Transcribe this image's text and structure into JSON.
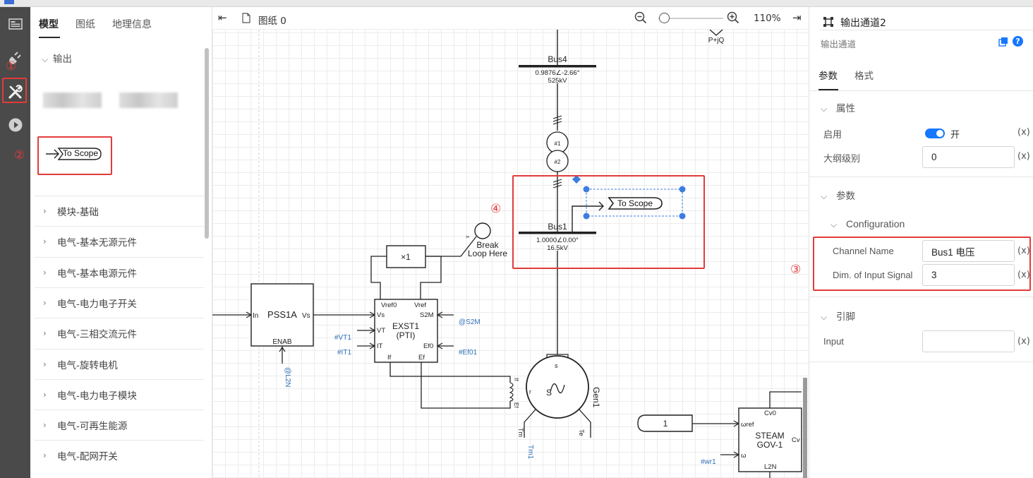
{
  "rail": {
    "items": [
      "panel-icon",
      "plug-icon",
      "tools-icon",
      "play-icon"
    ]
  },
  "library": {
    "tabs": [
      "模型",
      "图纸",
      "地理信息"
    ],
    "active_tab": "模型",
    "section_output": "输出",
    "to_scope_block": "To Scope",
    "categories": [
      "模块-基础",
      "电气-基本无源元件",
      "电气-基本电源元件",
      "电气-电力电子开关",
      "电气-三相交流元件",
      "电气-旋转电机",
      "电气-电力电子模块",
      "电气-可再生能源",
      "电气-配网开关"
    ]
  },
  "annotations": {
    "n1": "①",
    "n2": "②",
    "n3": "③",
    "n4": "④"
  },
  "canvas": {
    "tab_title": "图纸 0",
    "zoom": "110%",
    "diagram": {
      "pq_label": "P+jQ",
      "bus4_name": "Bus4",
      "bus4_value": "0.9876∠-2.66°",
      "bus4_kv": "525kV",
      "bus1_name": "Bus1",
      "bus1_value": "1.0000∠0.00°",
      "bus1_kv": "16.5kV",
      "tr_top": "#1",
      "tr_bottom": "#2",
      "to_scope": "To Scope",
      "break_loop_1": "Break",
      "break_loop_2": "Loop Here",
      "gain": "×1",
      "pss_name": "PSS1A",
      "pss_in": "In",
      "pss_vs": "Vs",
      "pss_enab": "ENAB",
      "pss_signal": "@L2N",
      "exst_name1": "EXST1",
      "exst_name2": "(PTI)",
      "exst_vref0": "Vref0",
      "exst_vref": "Vref",
      "exst_vs": "Vs",
      "exst_s2m": "S2M",
      "exst_vt": "VT",
      "exst_it": "IT",
      "exst_ef0": "Ef0",
      "exst_if": "If",
      "exst_ef": "Ef",
      "sig_s2m": "@S2M",
      "sig_vt1": "#VT1",
      "sig_it1": "#IT1",
      "sig_ef01": "#Ef01",
      "gen_name": "Gen1",
      "gen_s": "S",
      "gen_s_top": "s",
      "gen_r": "r",
      "gen_if": "If",
      "gen_ef": "Ef",
      "gen_tm": "Tm",
      "gen_te": "Te",
      "sig_tm1": "Tm1",
      "const_one": "1",
      "steam_name1": "STEAM",
      "steam_name2": "GOV-1",
      "steam_cv0": "Cv0",
      "steam_wref": "ωref",
      "steam_w": "ω",
      "steam_cv": "Cv",
      "steam_l2n": "L2N",
      "sig_wr1": "#wr1"
    }
  },
  "props": {
    "title": "输出通道2",
    "subtitle": "输出通道",
    "tabs": [
      "参数",
      "格式"
    ],
    "section_attr": "属性",
    "enable_label": "启用",
    "enable_value": "开",
    "outline_label": "大纲级别",
    "outline_value": "0",
    "section_params": "参数",
    "section_config": "Configuration",
    "channel_name_label": "Channel Name",
    "channel_name_value": "Bus1 电压",
    "dim_label": "Dim. of Input Signal",
    "dim_value": "3",
    "section_pins": "引脚",
    "input_label": "Input",
    "input_value": "",
    "x_marker": "(x)"
  }
}
